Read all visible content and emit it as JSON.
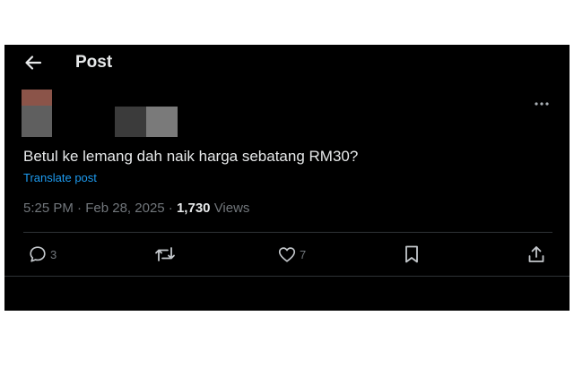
{
  "header": {
    "back_icon": "arrow-left-icon",
    "title": "Post"
  },
  "colors": {
    "background": "#000000",
    "text_primary": "#e7e9ea",
    "text_secondary": "#71767b",
    "link": "#1d9bf0",
    "divider": "#2f3336"
  },
  "post": {
    "text": "Betul ke lemang dah naik harga sebatang RM30?",
    "translate_label": "Translate post",
    "time": "5:25 PM",
    "date": "Feb 28, 2025",
    "separator": "·",
    "views_count": "1,730",
    "views_label": "Views"
  },
  "actions": {
    "reply_count": "3",
    "like_count": "7",
    "icons": [
      "reply-icon",
      "repost-icon",
      "like-icon",
      "bookmark-icon",
      "share-icon"
    ]
  }
}
